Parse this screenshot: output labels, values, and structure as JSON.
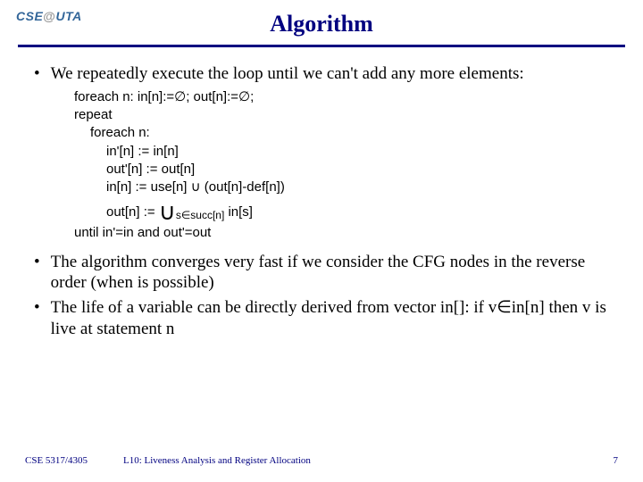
{
  "logo": {
    "left": "CSE",
    "at": "@",
    "right": "UTA"
  },
  "title": "Algorithm",
  "bullets": {
    "b1": "We repeatedly execute the loop until we can't add any more elements:",
    "b2": "The algorithm converges very fast if we consider the CFG nodes in the reverse order (when is possible)",
    "b3": "The life of a variable can be directly derived from vector in[]: if v∈in[n] then v is live at statement n"
  },
  "code": {
    "l1": "foreach n:   in[n]:=∅; out[n]:=∅;",
    "l2": "repeat",
    "l3": "foreach n:",
    "l4": "in'[n] := in[n]",
    "l5": "out'[n] := out[n]",
    "l6": "in[n] := use[n] ∪ (out[n]-def[n])",
    "l7a": "out[n] := ",
    "l7b": "s∈succ[n]",
    "l7c": " in[s]",
    "l8": "until in'=in  and  out'=out"
  },
  "footer": {
    "course": "CSE 5317/4305",
    "lecture": "L10: Liveness Analysis and Register Allocation",
    "page": "7"
  }
}
